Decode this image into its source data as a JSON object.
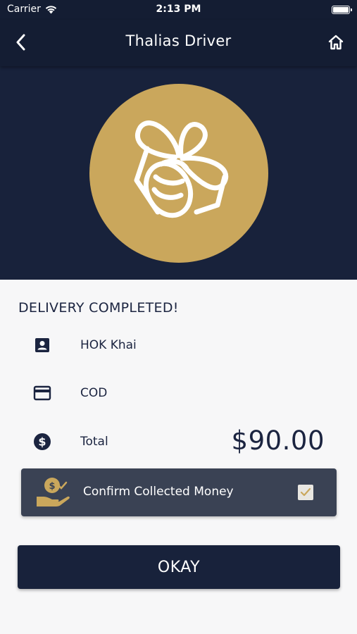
{
  "status_bar": {
    "carrier": "Carrier",
    "time": "2:13 PM"
  },
  "nav": {
    "title": "Thalias Driver",
    "back_icon": "chevron-left-icon",
    "home_icon": "home-icon"
  },
  "hero": {
    "logo_icon": "bee-logo-icon",
    "logo_bg_color": "#caa75c"
  },
  "delivery": {
    "heading": "DELIVERY COMPLETED!",
    "customer_name": "HOK Khai",
    "payment_method": "COD",
    "total_label": "Total",
    "total_value": "$90.00"
  },
  "confirm": {
    "label": "Confirm Collected Money",
    "checked": true,
    "icon": "hand-money-icon"
  },
  "actions": {
    "okay_label": "OKAY"
  },
  "colors": {
    "navy": "#141d33",
    "gold": "#caa75c",
    "card": "#3a4254"
  }
}
